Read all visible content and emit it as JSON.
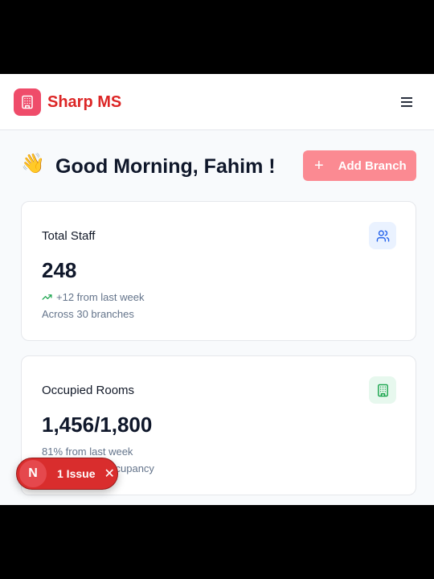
{
  "brand": {
    "name": "Sharp MS",
    "logo_icon": "building-icon",
    "color": "#dc2626"
  },
  "header": {
    "menu_icon": "hamburger-menu-icon"
  },
  "greeting": {
    "emoji": "👋",
    "text": "Good Morning, Fahim !"
  },
  "add_branch": {
    "label": "Add Branch",
    "icon": "plus-icon",
    "color": "#fb8a92"
  },
  "cards": [
    {
      "title": "Total Staff",
      "icon": "users-icon",
      "value": "248",
      "trend_icon": "trending-up-icon",
      "change": "+12 from last week",
      "detail": "Across 30 branches"
    },
    {
      "title": "Occupied Rooms",
      "icon": "building-icon",
      "value": "1,456/1,800",
      "change": "81% from last week",
      "detail": "…ccupancy"
    }
  ],
  "issue_badge": {
    "letter": "N",
    "label": "1 Issue",
    "close": "✕",
    "color": "#d92d2d"
  }
}
